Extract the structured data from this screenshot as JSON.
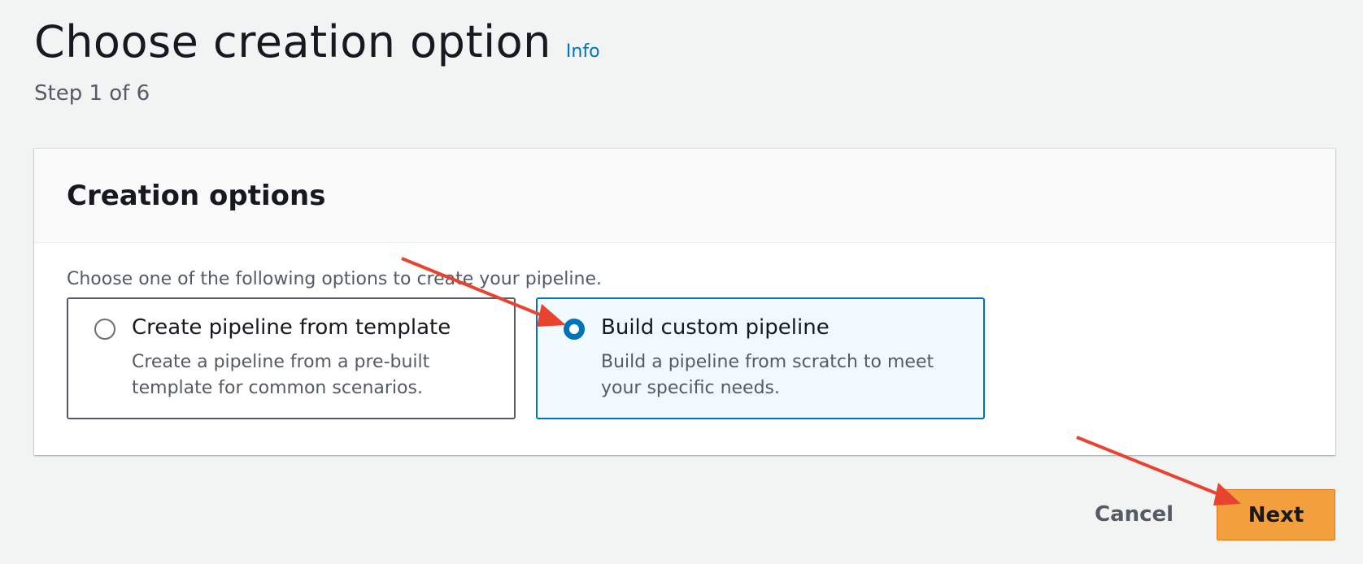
{
  "header": {
    "title": "Choose creation option",
    "info_label": "Info",
    "step": "Step 1 of 6"
  },
  "panel": {
    "title": "Creation options",
    "instruction": "Choose one of the following options to create your pipeline.",
    "options": [
      {
        "title": "Create pipeline from template",
        "description": "Create a pipeline from a pre-built template for common scenarios.",
        "selected": false
      },
      {
        "title": "Build custom pipeline",
        "description": "Build a pipeline from scratch to meet your specific needs.",
        "selected": true
      }
    ]
  },
  "footer": {
    "cancel_label": "Cancel",
    "next_label": "Next"
  },
  "colors": {
    "accent": "#0073bb",
    "primary_button": "#f29f3d",
    "annotation_arrow": "#e8432e"
  },
  "icons": [
    "radio-unselected-icon",
    "radio-selected-icon",
    "annotation-arrow-icon"
  ]
}
